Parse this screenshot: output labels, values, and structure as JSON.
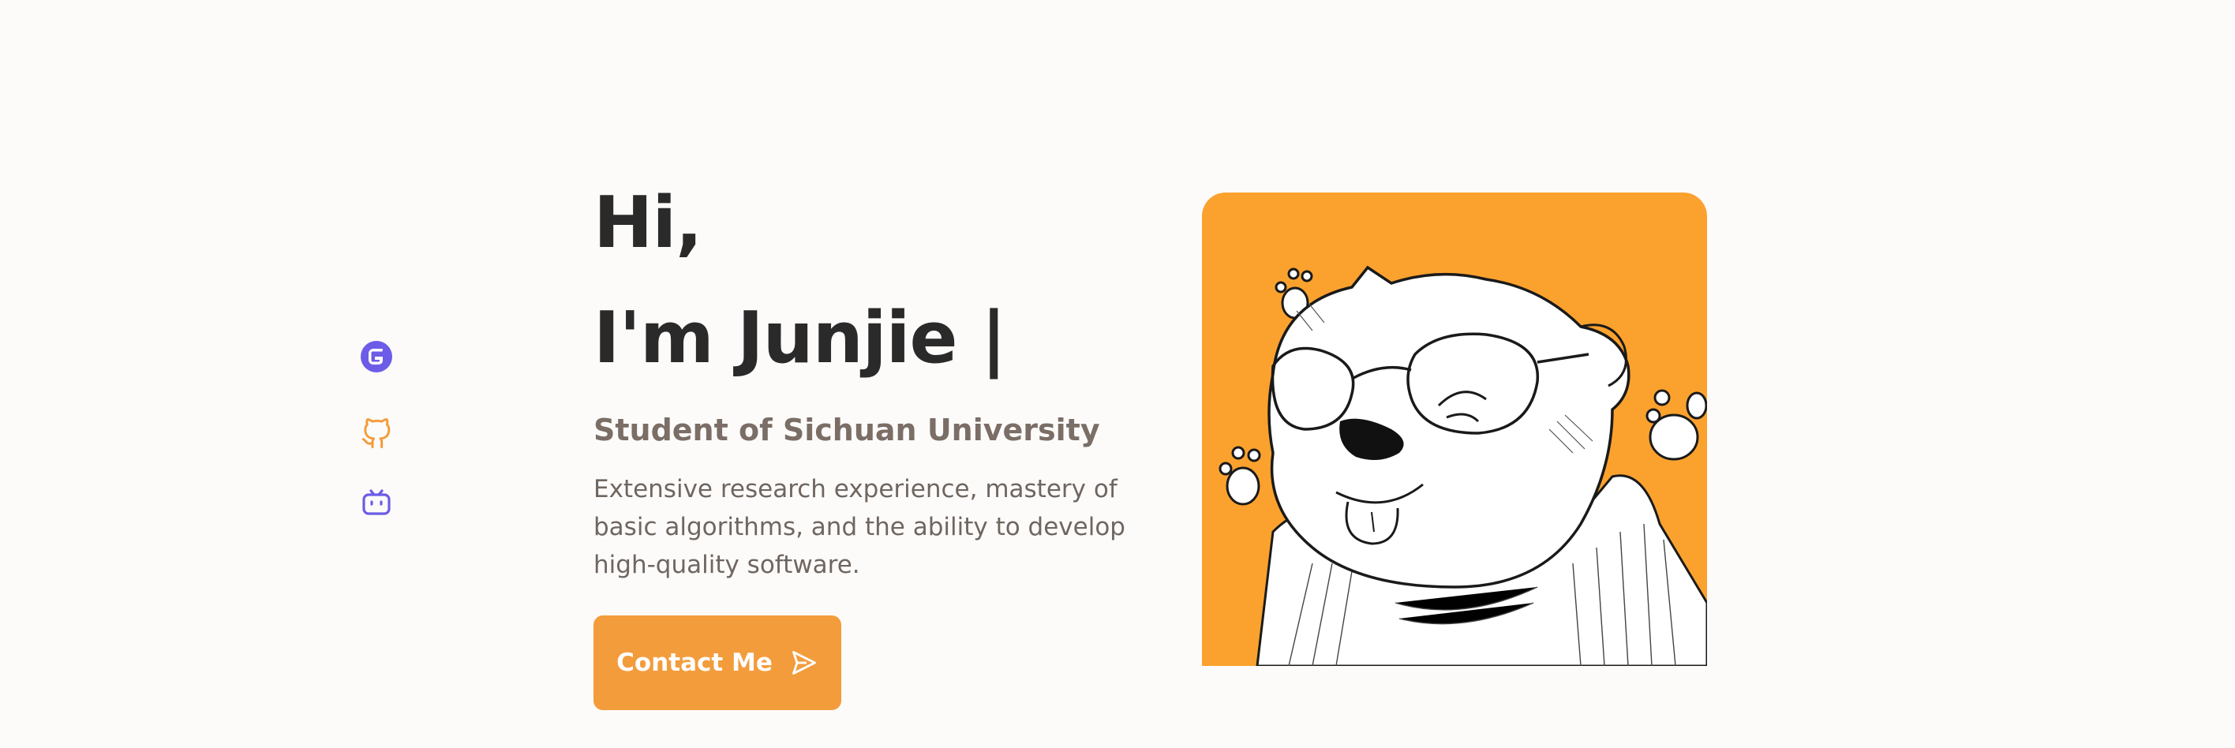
{
  "social": [
    {
      "name": "gitee",
      "icon": "gitee-icon",
      "color": "#6c5ce7"
    },
    {
      "name": "github",
      "icon": "github-icon",
      "color": "#f39c3c"
    },
    {
      "name": "bilibili",
      "icon": "bilibili-icon",
      "color": "#6c5ce7"
    }
  ],
  "hero": {
    "greeting_line1": "Hi,",
    "greeting_line2": "I'm Junjie",
    "cursor": "|",
    "subtitle": "Student of Sichuan University",
    "description": "Extensive research experience, mastery of basic algorithms, and the ability to develop high-quality software.",
    "contact_label": "Contact Me",
    "contact_icon": "send-icon"
  },
  "avatar": {
    "icon": "bear-avatar-illustration",
    "background": "#fba22e"
  },
  "colors": {
    "accent": "#f39c3c",
    "heading": "#2a2a2a",
    "subtitle": "#7a6e67",
    "body": "#6f6661",
    "page_bg": "#fdfbf9"
  }
}
